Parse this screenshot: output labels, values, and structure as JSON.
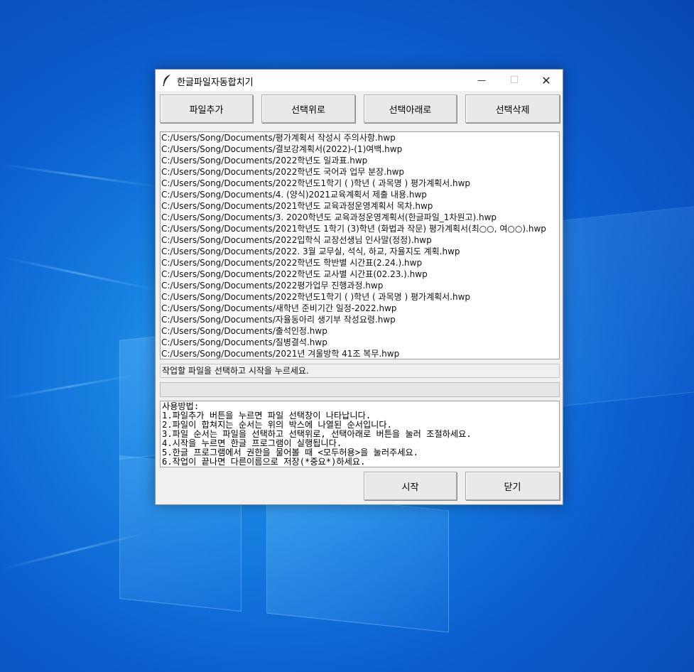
{
  "window": {
    "title": "한글파일자동합치기",
    "minimize": "—",
    "maximize": "☐",
    "close": "✕"
  },
  "toolbar": {
    "add_file": "파일추가",
    "move_up": "선택위로",
    "move_down": "선택아래로",
    "delete": "선택삭제"
  },
  "files": [
    "C:/Users/Song/Documents/평가계획서 작성시 주의사항.hwp",
    "C:/Users/Song/Documents/결보강계획서(2022)-(1)여백.hwp",
    "C:/Users/Song/Documents/2022학년도 일과표.hwp",
    "C:/Users/Song/Documents/2022학년도 국어과 업무 분장.hwp",
    "C:/Users/Song/Documents/2022학년도1학기 (  )학년 (   과목명    ) 평가계획서.hwp",
    "C:/Users/Song/Documents/4. (양식)2021교육계획서 제출 내용.hwp",
    "C:/Users/Song/Documents/2021학년도 교육과정운영계획서 목차.hwp",
    "C:/Users/Song/Documents/3. 2020학년도 교육과정운영계획서(한글파일_1차원고).hwp",
    "C:/Users/Song/Documents/2021학년도 1학기  (3)학년 (화법과 작문) 평가계획서(최○○, 여○○).hwp",
    "C:/Users/Song/Documents/2022입학식 교장선생님 인사말(정정).hwp",
    "C:/Users/Song/Documents/2022. 3월 교무실, 석식, 하교, 자율지도 계획.hwp",
    "C:/Users/Song/Documents/2022학년도 학반별 시간표(2.24.).hwp",
    "C:/Users/Song/Documents/2022학년도 교사별 시간표(02.23.).hwp",
    "C:/Users/Song/Documents/2022평가업무 진행과정.hwp",
    "C:/Users/Song/Documents/2022학년도1학기 ( )학년 (   과목명    ) 평가계획서.hwp",
    "C:/Users/Song/Documents/새학년 준비기간 일정-2022.hwp",
    "C:/Users/Song/Documents/자율동아리 생기부 작성요령.hwp",
    "C:/Users/Song/Documents/출석인정.hwp",
    "C:/Users/Song/Documents/질병결석.hwp",
    "C:/Users/Song/Documents/2021년 겨울방학 41조 복무.hwp"
  ],
  "status_text": "작업할 파일을 선택하고 시작을 누르세요.",
  "progress_percent": 0,
  "progress_color": "#06b025",
  "usage": [
    "사용방법:",
    "1.파일추가 버튼을 누르면 파일 선택창이 나타납니다.",
    "2.파일이 합쳐지는 순서는 위의 박스에 나열된 순서입니다.",
    "3.파일 순서는 파일을 선택하고 선택위로, 선택아래로 버튼을 눌러 조절하세요.",
    "4.시작을 누르면 한글 프로그램이 실행됩니다.",
    "5.한글 프로그램에서 권한을 물어볼 때 <모두허용>을 눌러주세요.",
    "6.작업이 끝나면 다른이름으로 저장(*중요*)하세요."
  ],
  "footer": {
    "start": "시작",
    "close": "닫기"
  },
  "icons": {
    "app": "feather-icon"
  }
}
